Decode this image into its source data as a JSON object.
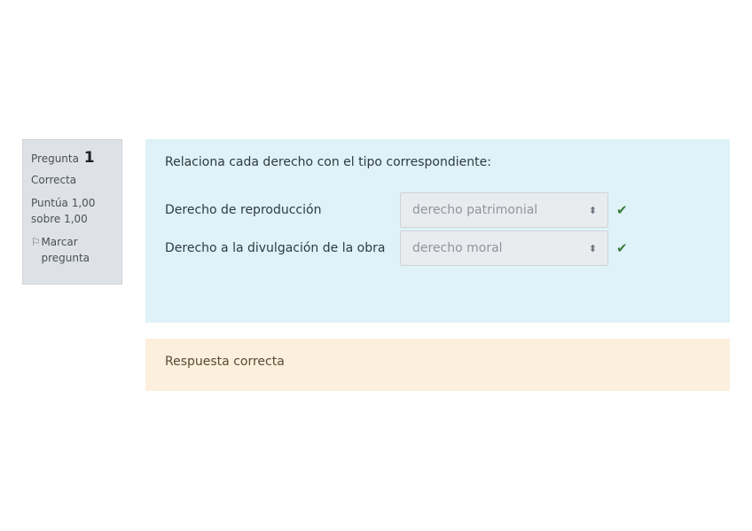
{
  "info": {
    "question_word": "Pregunta",
    "question_number": "1",
    "state": "Correcta",
    "grade": "Puntúa 1,00 sobre 1,00",
    "flag_label": "Marcar pregunta"
  },
  "question": {
    "text": "Relaciona cada derecho con el tipo correspondiente:",
    "rows": [
      {
        "label": "Derecho de reproducción",
        "selected": "derecho patrimonial",
        "correct": true
      },
      {
        "label": "Derecho a la divulgación de la obra",
        "selected": "derecho moral",
        "correct": true
      }
    ]
  },
  "feedback": {
    "text": "Respuesta correcta"
  },
  "colors": {
    "info_bg": "#dee2e6",
    "question_bg": "#def2f8",
    "feedback_bg": "#fcefdc",
    "check": "#3a7d3c"
  }
}
